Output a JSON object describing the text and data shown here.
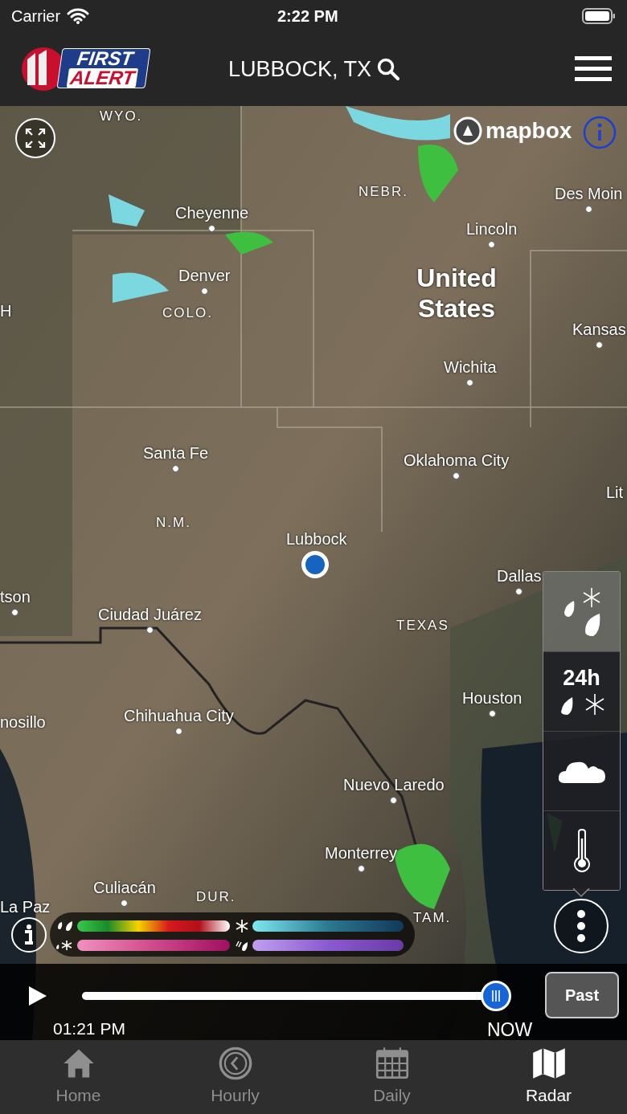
{
  "status_bar": {
    "carrier": "Carrier",
    "time": "2:22 PM"
  },
  "header": {
    "logo_top": "FIRST",
    "logo_bottom": "ALERT",
    "location": "LUBBOCK, TX"
  },
  "map": {
    "attribution": "mapbox",
    "labels": [
      {
        "text": "WYO.",
        "kind": "region",
        "dot": false
      },
      {
        "text": "NEBR.",
        "kind": "region",
        "dot": false
      },
      {
        "text": "Des Moin",
        "kind": "city",
        "dot": true
      },
      {
        "text": "Cheyenne",
        "kind": "city",
        "dot": true
      },
      {
        "text": "Lincoln",
        "kind": "city",
        "dot": true
      },
      {
        "text": "Denver",
        "kind": "city",
        "dot": true
      },
      {
        "text": "H",
        "kind": "city",
        "dot": false
      },
      {
        "text": "COLO.",
        "kind": "region",
        "dot": false
      },
      {
        "text": "United States",
        "kind": "country",
        "dot": false
      },
      {
        "text": "Kansas",
        "kind": "city",
        "dot": true
      },
      {
        "text": "Wichita",
        "kind": "city",
        "dot": true
      },
      {
        "text": "Santa Fe",
        "kind": "city",
        "dot": true
      },
      {
        "text": "Oklahoma City",
        "kind": "city",
        "dot": true
      },
      {
        "text": "Lit",
        "kind": "city",
        "dot": false
      },
      {
        "text": "N.M.",
        "kind": "region",
        "dot": false
      },
      {
        "text": "Lubbock",
        "kind": "city",
        "dot": false
      },
      {
        "text": "Dallas",
        "kind": "city",
        "dot": true
      },
      {
        "text": "tson",
        "kind": "city",
        "dot": true
      },
      {
        "text": "Ciudad Juárez",
        "kind": "city",
        "dot": true
      },
      {
        "text": "TEXAS",
        "kind": "region",
        "dot": false
      },
      {
        "text": "Houston",
        "kind": "city",
        "dot": true
      },
      {
        "text": "nosillo",
        "kind": "city",
        "dot": false
      },
      {
        "text": "Chihuahua City",
        "kind": "city",
        "dot": true
      },
      {
        "text": "Nuevo Laredo",
        "kind": "city",
        "dot": true
      },
      {
        "text": "Monterrey",
        "kind": "city",
        "dot": true
      },
      {
        "text": "Culiacán",
        "kind": "city",
        "dot": true
      },
      {
        "text": "DUR.",
        "kind": "region",
        "dot": false
      },
      {
        "text": "La Paz",
        "kind": "city",
        "dot": false
      },
      {
        "text": "TAM.",
        "kind": "region",
        "dot": false
      }
    ]
  },
  "layers": [
    {
      "kind": "precip",
      "selected": true
    },
    {
      "kind": "accumulation",
      "label": "24h",
      "selected": false
    },
    {
      "kind": "clouds",
      "selected": false
    },
    {
      "kind": "temperature",
      "selected": false
    }
  ],
  "timeline": {
    "level": 1,
    "start_time": "01:21 PM",
    "end_label": "NOW",
    "mode_button": "Past"
  },
  "tabs": [
    {
      "label": "Home",
      "kind": "home",
      "selected": false
    },
    {
      "label": "Hourly",
      "kind": "hourly",
      "selected": false
    },
    {
      "label": "Daily",
      "kind": "daily",
      "selected": false
    },
    {
      "label": "Radar",
      "kind": "radar",
      "selected": true
    }
  ]
}
